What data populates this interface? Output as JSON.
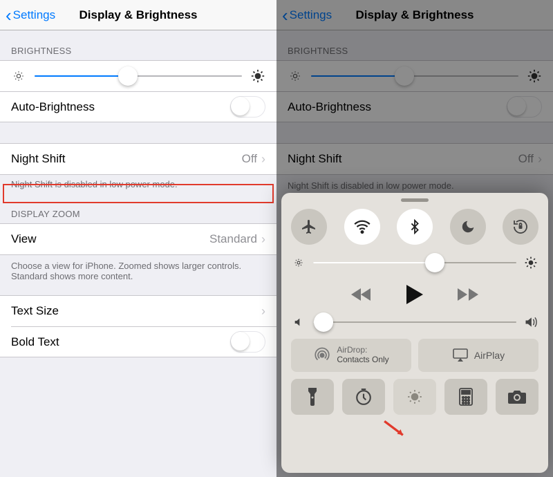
{
  "left": {
    "nav": {
      "back_label": "Settings",
      "title": "Display & Brightness"
    },
    "brightness": {
      "header": "BRIGHTNESS",
      "slider_percent": 45,
      "auto_label": "Auto-Brightness",
      "auto_on": false
    },
    "nightshift": {
      "label": "Night Shift",
      "value": "Off",
      "footnote": "Night Shift is disabled in low power mode."
    },
    "zoom": {
      "header": "DISPLAY ZOOM",
      "view_label": "View",
      "view_value": "Standard",
      "footnote": "Choose a view for iPhone. Zoomed shows larger controls. Standard shows more content."
    },
    "text_size_label": "Text Size",
    "bold_label": "Bold Text",
    "bold_on": false
  },
  "right": {
    "nav": {
      "back_label": "Settings",
      "title": "Display & Brightness"
    },
    "brightness": {
      "header": "BRIGHTNESS",
      "slider_percent": 45,
      "auto_label": "Auto-Brightness",
      "auto_on": false
    },
    "nightshift": {
      "label": "Night Shift",
      "value": "Off",
      "footnote": "Night Shift is disabled in low power mode."
    },
    "cc": {
      "toggles": {
        "airplane": "airplane-icon",
        "wifi": "wifi-icon",
        "bluetooth": "bluetooth-icon",
        "dnd": "moon-icon",
        "lock": "rotation-lock-icon",
        "wifi_on": true,
        "bluetooth_on": true
      },
      "brightness_percent": 60,
      "volume_percent": 5,
      "airdrop_title": "AirDrop:",
      "airdrop_value": "Contacts Only",
      "airplay_label": "AirPlay",
      "bottom": [
        "flashlight-icon",
        "timer-icon",
        "nightshift-icon",
        "calculator-icon",
        "camera-icon"
      ]
    }
  }
}
